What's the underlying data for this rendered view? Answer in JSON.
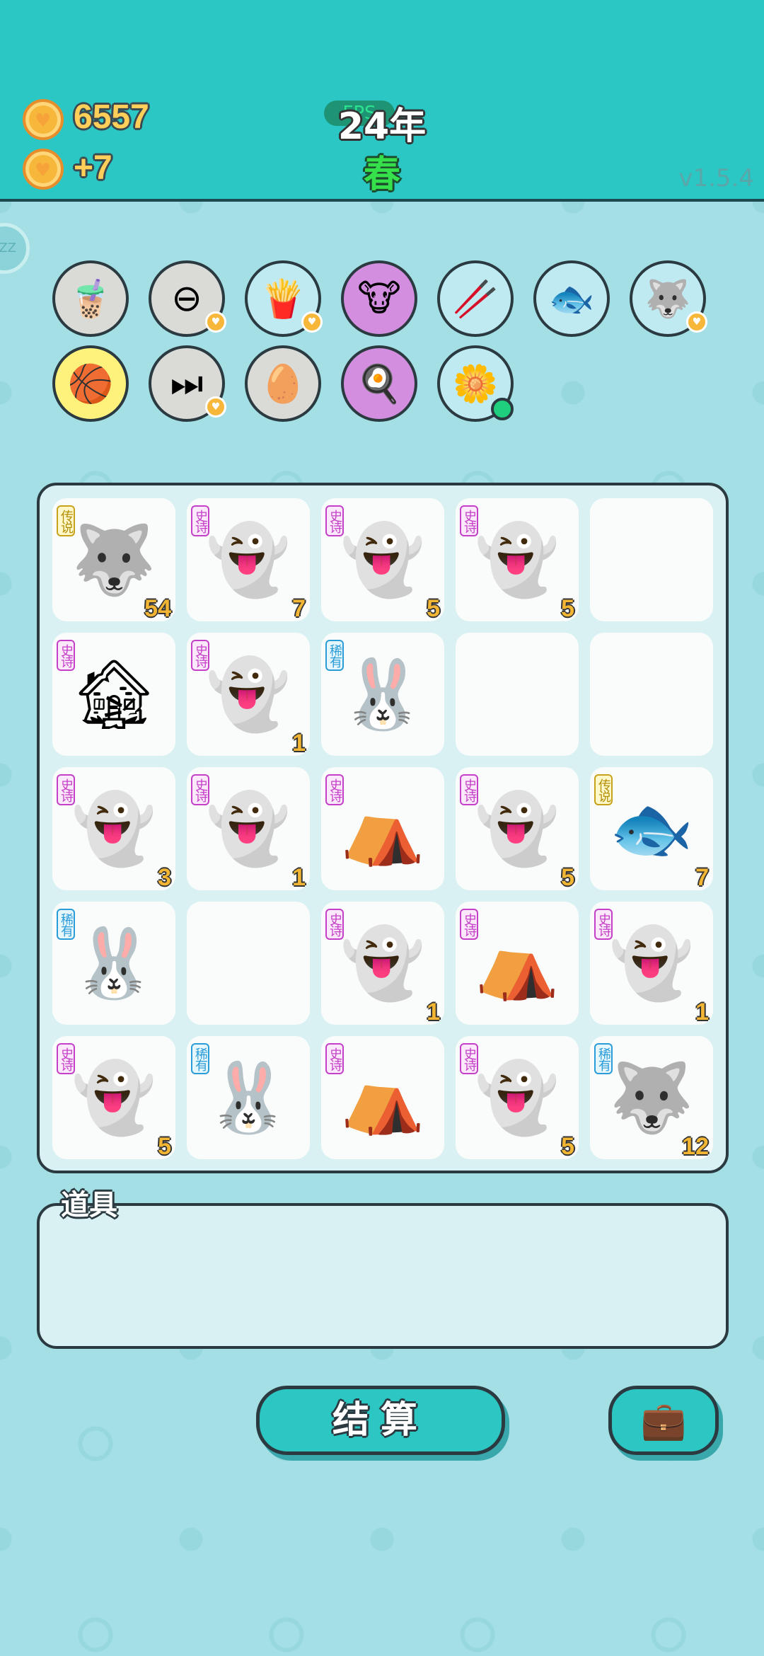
{
  "header": {
    "coins": "6557",
    "income": "+7",
    "year": "24年",
    "fps": "FPS",
    "season": "春",
    "version": "v1.5.4"
  },
  "sidebar": {
    "side_button": "ZZ"
  },
  "items_row1": [
    {
      "name": "bubble-tea",
      "glyph": "🧋",
      "bg": "#dadad6",
      "fav": false
    },
    {
      "name": "minus",
      "glyph": "⊖",
      "bg": "#dadad6",
      "fav": true
    },
    {
      "name": "fries",
      "glyph": "🍟",
      "bg": "#bfeaf2",
      "fav": true
    },
    {
      "name": "cow-card",
      "glyph": "🐮",
      "bg": "#d48ee0",
      "fav": false
    },
    {
      "name": "chopsticks",
      "glyph": "🥢",
      "bg": "#bfeaf2",
      "fav": false
    },
    {
      "name": "fish-tank",
      "glyph": "🐟",
      "bg": "#bfeaf2",
      "fav": false
    },
    {
      "name": "husky",
      "glyph": "🐺",
      "bg": "#bfeaf2",
      "fav": true
    }
  ],
  "items_row2": [
    {
      "name": "basketballs",
      "glyph": "🏀",
      "bg": "#fff27c",
      "fav": false
    },
    {
      "name": "skip",
      "glyph": "⏭",
      "bg": "#dadad6",
      "fav": true
    },
    {
      "name": "egg-tray",
      "glyph": "🥚",
      "bg": "#dadad6",
      "fav": false
    },
    {
      "name": "egg",
      "glyph": "🍳",
      "bg": "#d48ee0",
      "fav": false
    },
    {
      "name": "flower-pot",
      "glyph": "🌼",
      "bg": "#bfeaf2",
      "fav": false,
      "dot": true
    }
  ],
  "board": [
    [
      {
        "glyph": "🐺",
        "tag": "legend",
        "count": "54"
      },
      {
        "glyph": "👻",
        "tag": "epic",
        "count": "7"
      },
      {
        "glyph": "👻",
        "tag": "epic",
        "count": "5"
      },
      {
        "glyph": "👻",
        "tag": "epic",
        "count": "5"
      },
      {}
    ],
    [
      {
        "glyph": "🏚",
        "tag": "epic",
        "count": ""
      },
      {
        "glyph": "👻",
        "tag": "epic",
        "count": "1"
      },
      {
        "glyph": "🐰",
        "tag": "rare",
        "count": ""
      },
      {},
      {}
    ],
    [
      {
        "glyph": "👻",
        "tag": "epic",
        "count": "3"
      },
      {
        "glyph": "👻",
        "tag": "epic",
        "count": "1"
      },
      {
        "glyph": "⛺",
        "tag": "epic",
        "count": ""
      },
      {
        "glyph": "👻",
        "tag": "epic",
        "count": "5"
      },
      {
        "glyph": "🐟",
        "tag": "legend",
        "count": "7"
      }
    ],
    [
      {
        "glyph": "🐰",
        "tag": "rare",
        "count": ""
      },
      {},
      {
        "glyph": "👻",
        "tag": "epic",
        "count": "1"
      },
      {
        "glyph": "⛺",
        "tag": "epic",
        "count": ""
      },
      {
        "glyph": "👻",
        "tag": "epic",
        "count": "1"
      }
    ],
    [
      {
        "glyph": "👻",
        "tag": "epic",
        "count": "5"
      },
      {
        "glyph": "🐰",
        "tag": "rare",
        "count": ""
      },
      {
        "glyph": "⛺",
        "tag": "epic",
        "count": ""
      },
      {
        "glyph": "👻",
        "tag": "epic",
        "count": "5"
      },
      {
        "glyph": "🐺",
        "tag": "rare",
        "count": "12"
      }
    ]
  ],
  "tags": {
    "epic": "史诗",
    "rare": "稀有",
    "legend": "传说"
  },
  "props": {
    "label": "道具"
  },
  "actions": {
    "settle_label": "结算",
    "bag_glyph": "💼"
  }
}
